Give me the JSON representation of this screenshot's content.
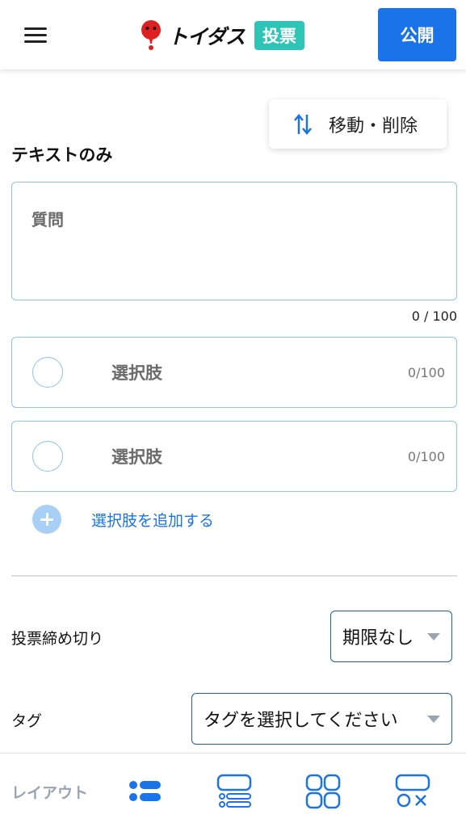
{
  "header": {
    "logo_text": "トイダス",
    "badge": "投票",
    "publish_label": "公開",
    "colors": {
      "brand_blue": "#1a73e8",
      "badge_teal": "#2ec4b6",
      "logo_red": "#e02020"
    }
  },
  "toolbar": {
    "move_delete_label": "移動・削除",
    "icon": "sort-arrows-icon"
  },
  "section": {
    "title": "テキストのみ"
  },
  "question": {
    "placeholder": "質問",
    "counter": "0 / 100"
  },
  "choices": [
    {
      "placeholder": "選択肢",
      "counter": "0/100"
    },
    {
      "placeholder": "選択肢",
      "counter": "0/100"
    }
  ],
  "add_choice": {
    "label": "選択肢を追加する"
  },
  "deadline": {
    "label": "投票締め切り",
    "value": "期限なし"
  },
  "tags": {
    "label": "タグ",
    "value": "タグを選択してください"
  },
  "layout_bar": {
    "label": "レイアウト",
    "options": [
      "layout-list-icon",
      "layout-cards-icon",
      "layout-grid-icon",
      "layout-mixed-icon"
    ],
    "selected": "layout-list-icon"
  }
}
